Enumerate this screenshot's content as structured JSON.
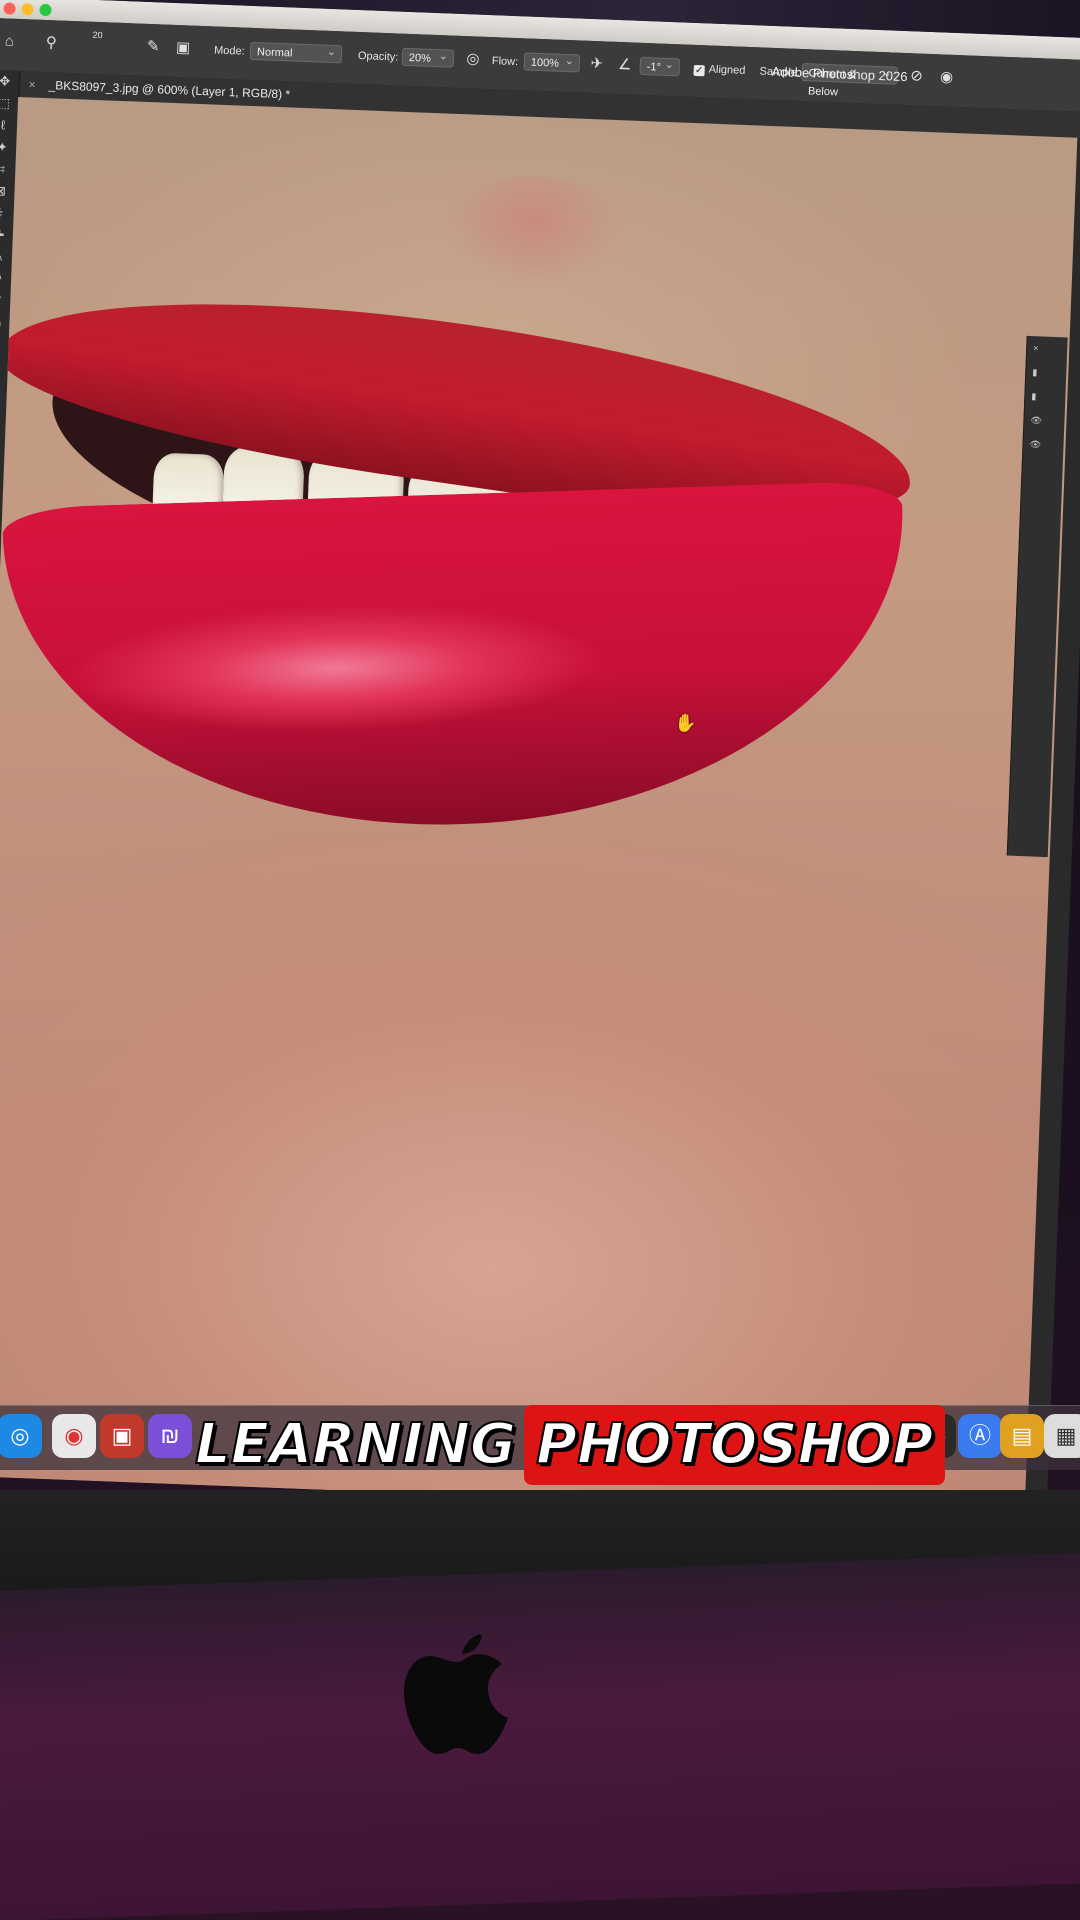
{
  "window": {
    "app_title": "Adobe Photoshop 2026"
  },
  "options_bar": {
    "brush_size": "20",
    "mode_label": "Mode:",
    "mode_value": "Normal",
    "opacity_label": "Opacity:",
    "opacity_value": "20%",
    "flow_label": "Flow:",
    "flow_value": "100%",
    "angle_value": "-1°",
    "aligned_label": "Aligned",
    "sample_label": "Sample:",
    "sample_value": "Current & Below"
  },
  "document": {
    "tab_title": "_BKS8097_3.jpg @ 600% (Layer 1, RGB/8) *"
  },
  "caption": {
    "part1": "LEARNING",
    "part2": "PHOTOSHOP"
  },
  "colors": {
    "caption_highlight": "#dc1414",
    "lip_red": "#c8103a"
  }
}
